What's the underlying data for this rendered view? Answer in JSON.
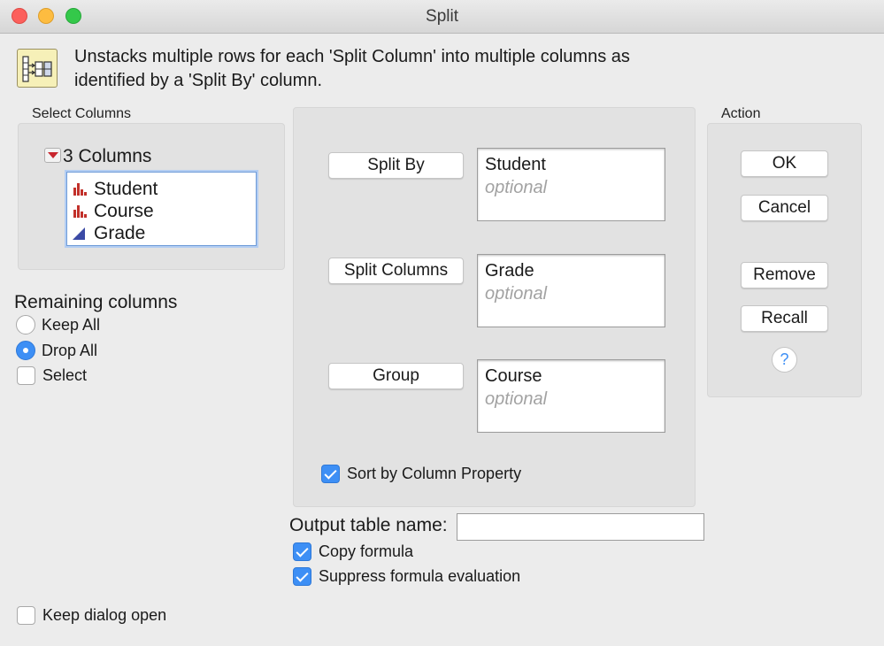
{
  "window": {
    "title": "Split"
  },
  "description": "Unstacks multiple rows for each 'Split Column' into multiple columns as identified by a 'Split By' column.",
  "select_columns": {
    "label": "Select Columns",
    "count_label": "3 Columns",
    "columns": [
      {
        "name": "Student",
        "icon": "nominal-icon"
      },
      {
        "name": "Course",
        "icon": "nominal-icon"
      },
      {
        "name": "Grade",
        "icon": "continuous-icon"
      }
    ]
  },
  "remaining": {
    "heading": "Remaining columns",
    "options": [
      {
        "label": "Keep All",
        "selected": false
      },
      {
        "label": "Drop All",
        "selected": true
      }
    ],
    "select_label": "Select"
  },
  "roles": [
    {
      "button": "Split By",
      "value": "Student",
      "placeholder": "optional"
    },
    {
      "button": "Split Columns",
      "value": "Grade",
      "placeholder": "optional"
    },
    {
      "button": "Group",
      "value": "Course",
      "placeholder": "optional"
    }
  ],
  "sort_by_column_property": {
    "label": "Sort by Column Property",
    "checked": true
  },
  "output": {
    "label": "Output table name:",
    "value": ""
  },
  "copy_formula": {
    "label": "Copy formula",
    "checked": true
  },
  "suppress_formula": {
    "label": "Suppress formula evaluation",
    "checked": true
  },
  "keep_dialog_open": {
    "label": "Keep dialog open",
    "checked": false
  },
  "action": {
    "label": "Action",
    "ok": "OK",
    "cancel": "Cancel",
    "remove": "Remove",
    "recall": "Recall",
    "help": "?"
  },
  "colors": {
    "accent": "#3d8ff5",
    "nominal": "#c2312b",
    "continuous": "#3b4aa5"
  }
}
